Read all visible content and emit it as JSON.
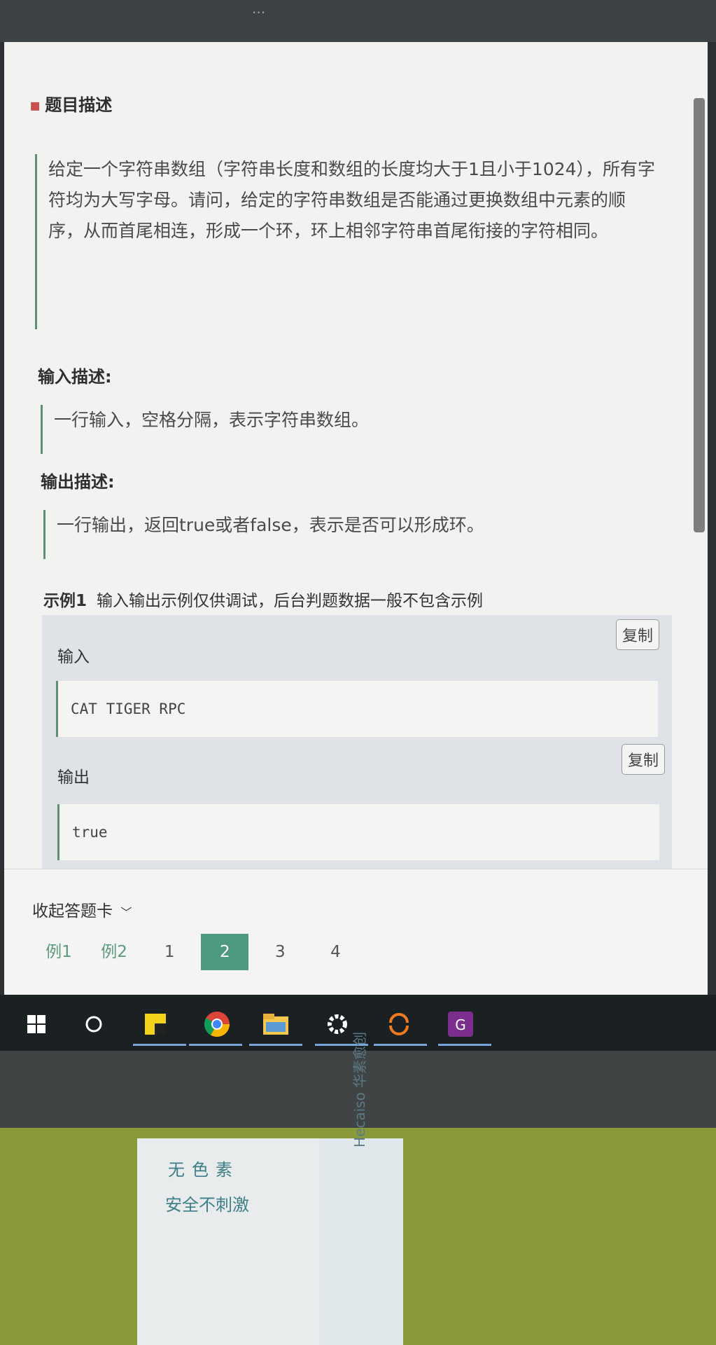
{
  "top_strip": {
    "text": "题目描述"
  },
  "description": {
    "title": "题目描述",
    "text": "给定一个字符串数组（字符串长度和数组的长度均大于1且小于1024），所有字符均为大写字母。请问，给定的字符串数组是否能通过更换数组中元素的顺序，从而首尾相连，形成一个环，环上相邻字符串首尾衔接的字符相同。"
  },
  "input": {
    "title": "输入描述:",
    "text": "一行输入，空格分隔，表示字符串数组。"
  },
  "output": {
    "title": "输出描述:",
    "text": "一行输出，返回true或者false，表示是否可以形成环。"
  },
  "example": {
    "heading": "示例1",
    "note": "输入输出示例仅供调试，后台判题数据一般不包含示例",
    "input_label": "输入",
    "input_value": "CAT TIGER RPC",
    "output_label": "输出",
    "output_value": "true",
    "copy_label": "复制"
  },
  "answer_card": {
    "collapse_label": "收起答题卡",
    "nav": [
      {
        "label": "例1",
        "state": "example"
      },
      {
        "label": "例2",
        "state": "example"
      },
      {
        "label": "1",
        "state": "normal"
      },
      {
        "label": "2",
        "state": "active"
      },
      {
        "label": "3",
        "state": "normal"
      },
      {
        "label": "4",
        "state": "normal"
      }
    ]
  },
  "taskbar": {
    "icons": [
      "windows-start-icon",
      "cortana-circle-icon",
      "sticky-notes-icon",
      "chrome-icon",
      "file-explorer-icon",
      "settings-gear-icon",
      "sync-app-icon",
      "pdf-app-icon"
    ]
  },
  "desk": {
    "box_line1": "无色素",
    "box_line2": "安全不刺激",
    "brand": "Hecaiso 华素愈创"
  },
  "colors": {
    "accent": "#4e9a7e",
    "border_green": "#5c8f75",
    "taskbar": "#1b2023"
  }
}
